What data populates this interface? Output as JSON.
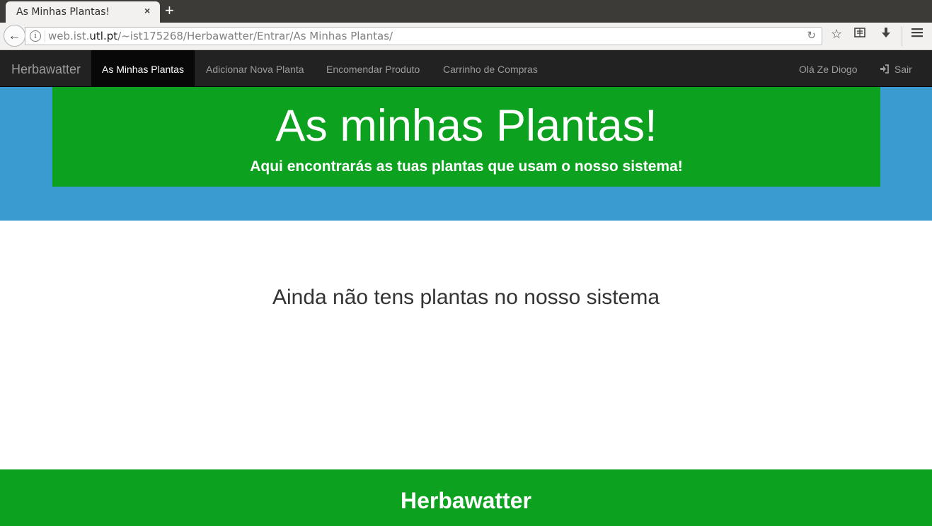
{
  "browser": {
    "tab_title": "As Minhas Plantas!",
    "tab_close": "×",
    "new_tab": "+",
    "url_prefix": "web.ist.",
    "url_domain": "utl.pt",
    "url_path": "/~ist175268/Herbawatter/Entrar/As Minhas Plantas/",
    "icons": [
      "back-arrow-icon",
      "info-icon",
      "reload-icon",
      "bookmark-star-icon",
      "reading-list-icon",
      "download-icon",
      "menu-icon"
    ]
  },
  "navbar": {
    "brand": "Herbawatter",
    "items": [
      {
        "label": "As Minhas Plantas",
        "active": true
      },
      {
        "label": "Adicionar Nova Planta",
        "active": false
      },
      {
        "label": "Encomendar Produto",
        "active": false
      },
      {
        "label": "Carrinho de Compras",
        "active": false
      }
    ],
    "greeting": "Olá Ze Diogo",
    "logout_label": "Sair"
  },
  "header": {
    "title": "As minhas Plantas!",
    "subtitle": "Aqui encontrarás as tuas plantas que usam o nosso sistema!"
  },
  "main": {
    "empty_message": "Ainda não tens plantas no nosso sistema"
  },
  "footer": {
    "title": "Herbawatter"
  },
  "colors": {
    "navbar_bg": "#222222",
    "active_nav_bg": "#080808",
    "header_green": "#0da120",
    "header_blue": "#399bcf",
    "footer_green": "#0da120"
  }
}
